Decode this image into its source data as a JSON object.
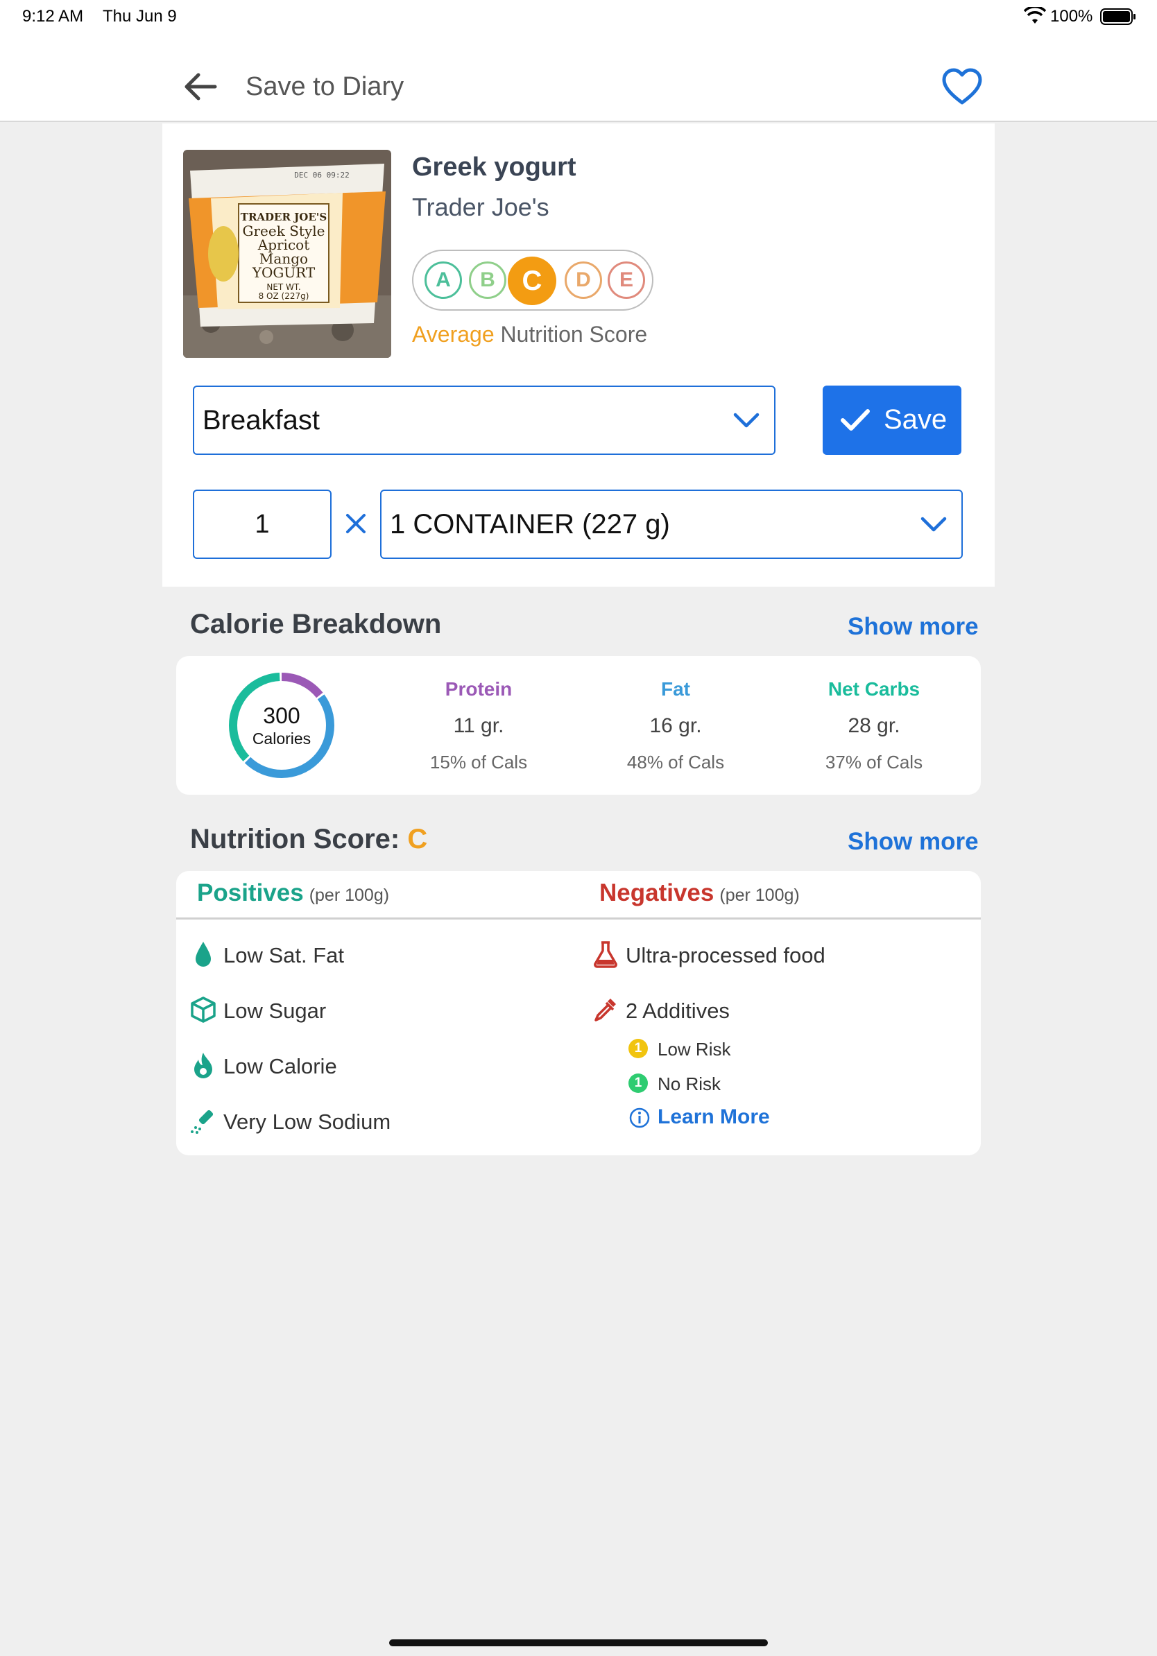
{
  "status_bar": {
    "time": "9:12 AM",
    "date": "Thu Jun 9",
    "battery": "100%"
  },
  "header": {
    "title": "Save to Diary"
  },
  "food": {
    "name": "Greek yogurt",
    "brand": "Trader Joe's",
    "grades": [
      "A",
      "B",
      "C",
      "D",
      "E"
    ],
    "selected_grade": "C",
    "score_word": "Average",
    "score_suffix": " Nutrition Score",
    "photo_label": [
      "TRADER JOE'S",
      "Greek Style",
      "Apricot",
      "Mango",
      "YOGURT",
      "NET WT.",
      "8 OZ (227g)"
    ],
    "photo_date": "DEC 06 09:22"
  },
  "form": {
    "meal": "Breakfast",
    "save_label": "Save",
    "quantity": "1",
    "unit": "1 CONTAINER (227 g)"
  },
  "calorie_breakdown": {
    "title": "Calorie Breakdown",
    "show_more": "Show more",
    "calories": "300",
    "calories_label": "Calories",
    "macros": [
      {
        "name": "Protein",
        "grams": "11 gr.",
        "pct": "15% of Cals",
        "color": "#9b59b6",
        "fraction": 0.15
      },
      {
        "name": "Fat",
        "grams": "16 gr.",
        "pct": "48% of Cals",
        "color": "#3a9ad9",
        "fraction": 0.48
      },
      {
        "name": "Net Carbs",
        "grams": "28 gr.",
        "pct": "37% of Cals",
        "color": "#1abc9c",
        "fraction": 0.37
      }
    ]
  },
  "nutrition_score": {
    "title": "Nutrition Score: ",
    "grade": "C",
    "show_more": "Show more",
    "positives_title": "Positives",
    "negatives_title": "Negatives",
    "per": "(per 100g)",
    "positives": [
      "Low Sat. Fat",
      "Low Sugar",
      "Low Calorie",
      "Very Low Sodium"
    ],
    "negatives": [
      "Ultra-processed food",
      "2 Additives"
    ],
    "additives": [
      {
        "count": "1",
        "label": "Low Risk",
        "color": "#f1c40f"
      },
      {
        "count": "1",
        "label": "No Risk",
        "color": "#2ecc71"
      }
    ],
    "learn_more": "Learn More"
  },
  "colors": {
    "accent": "#1e72e8",
    "grade_active": "#f39c12",
    "positive": "#1aa38a",
    "negative": "#c8362d"
  }
}
